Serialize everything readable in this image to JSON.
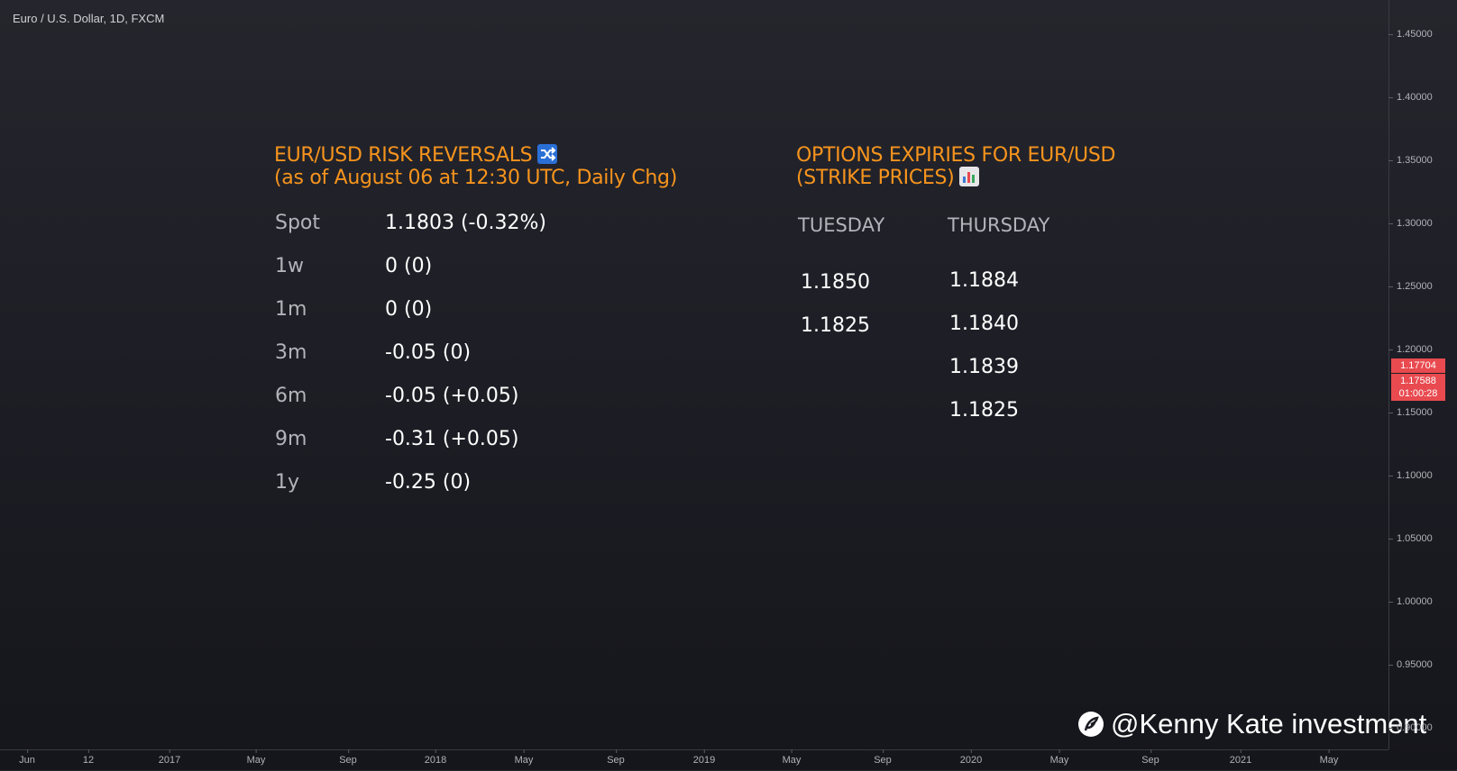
{
  "symbol": "Euro / U.S. Dollar, 1D, FXCM",
  "price_axis": {
    "ticks": [
      "1.45000",
      "1.40000",
      "1.35000",
      "1.30000",
      "1.25000",
      "1.20000",
      "1.15000",
      "1.10000",
      "1.05000",
      "1.00000",
      "0.95000",
      "0.90000"
    ],
    "labels": {
      "last": "1.17704",
      "current": "1.17588",
      "countdown": "01:00:28"
    }
  },
  "time_axis": {
    "ticks": [
      "Jun",
      "12",
      "2017",
      "May",
      "Sep",
      "2018",
      "May",
      "Sep",
      "2019",
      "May",
      "Sep",
      "2020",
      "May",
      "Sep",
      "2021",
      "May"
    ]
  },
  "risk_reversals": {
    "title_line1": "EUR/USD RISK REVERSALS",
    "title_line2": "(as of August 06 at 12:30 UTC, Daily Chg)",
    "title_icon": "shuffle-icon",
    "rows": [
      {
        "label": "Spot",
        "value": "1.1803 (-0.32%)"
      },
      {
        "label": "1w",
        "value": "0 (0)"
      },
      {
        "label": "1m",
        "value": "0 (0)"
      },
      {
        "label": "3m",
        "value": "-0.05 (0)"
      },
      {
        "label": "6m",
        "value": "-0.05 (+0.05)"
      },
      {
        "label": "9m",
        "value": "-0.31 (+0.05)"
      },
      {
        "label": "1y",
        "value": "-0.25 (0)"
      }
    ]
  },
  "options_expiries": {
    "title_line1": "OPTIONS EXPIRIES FOR EUR/USD",
    "title_line2": "(STRIKE PRICES)",
    "title_icon": "bar-chart-icon",
    "columns": [
      {
        "header": "TUESDAY",
        "strikes": [
          "1.1850",
          "1.1825"
        ]
      },
      {
        "header": "THURSDAY",
        "strikes": [
          "1.1884",
          "1.1840",
          "1.1839",
          "1.1825"
        ]
      }
    ]
  },
  "watermark": "@Kenny Kate investment",
  "colors": {
    "accent": "#f7941d",
    "price_label": "#e84a4f",
    "shuffle_icon": "#2a6fd6"
  }
}
